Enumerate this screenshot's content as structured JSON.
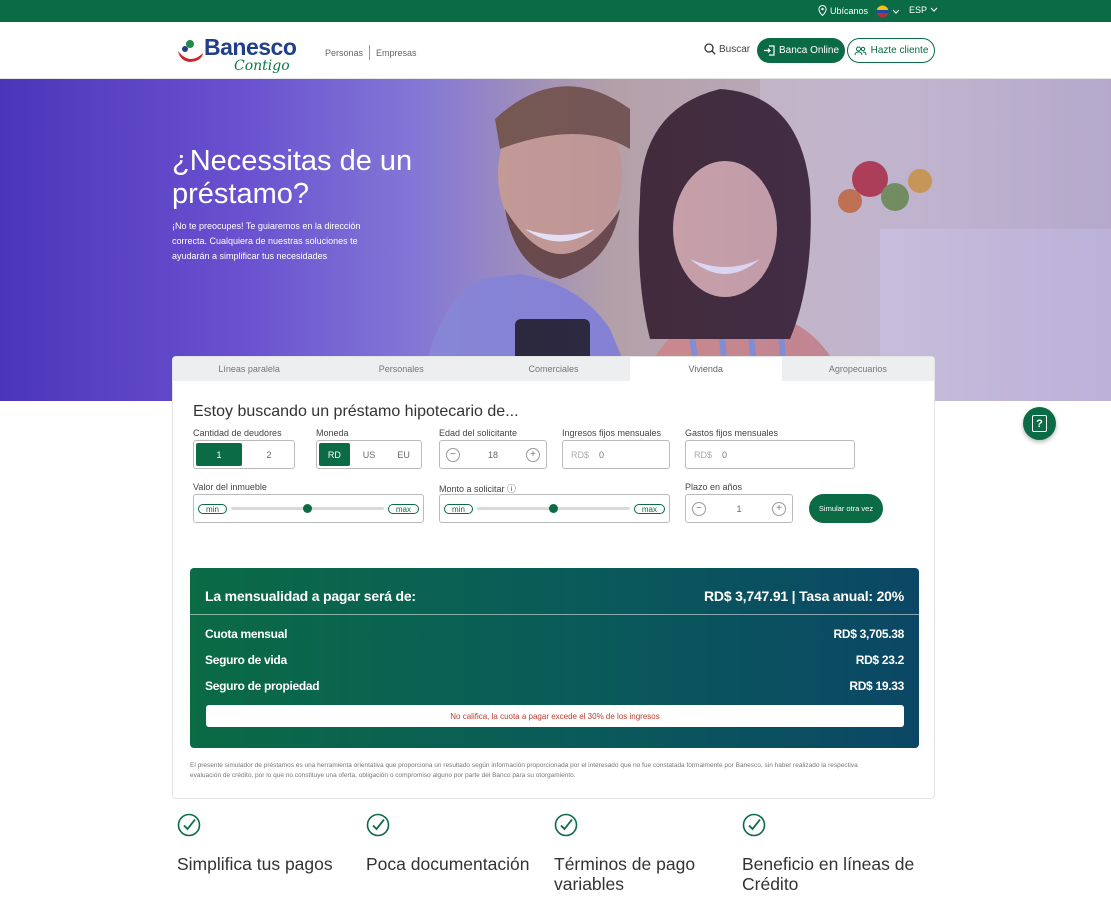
{
  "topbar": {
    "location": "Ubícanos",
    "language": "ESP"
  },
  "header": {
    "logo_name": "Banesco",
    "logo_tagline": "Contigo",
    "nav": [
      "Personas",
      "Empresas"
    ],
    "search_label": "Buscar",
    "online_label": "Banca Online",
    "client_label": "Hazte cliente"
  },
  "hero": {
    "title": "¿Necessitas de un préstamo?",
    "text": "¡No te preocupes! Te guiaremos en la dirección correcta. Cualquiera de nuestras soluciones te ayudarán a simplificar tus necesidades"
  },
  "simulator": {
    "tabs": [
      "Líneas paralela",
      "Personales",
      "Comerciales",
      "Vivienda",
      "Agropecuarios"
    ],
    "active_tab": "Vivienda",
    "heading": "Estoy buscando un préstamo hipotecario de...",
    "fields": {
      "deudores": {
        "label": "Cantidad de deudores",
        "options": [
          "1",
          "2"
        ],
        "selected": "1"
      },
      "moneda": {
        "label": "Moneda",
        "options": [
          "RD",
          "US",
          "EU"
        ],
        "selected": "RD"
      },
      "edad": {
        "label": "Edad del solicitante",
        "value": "18",
        "minus": "−",
        "plus": "+"
      },
      "ingresos": {
        "label": "Ingresos fijos mensuales",
        "currency": "RD$",
        "value": "0"
      },
      "gastos": {
        "label": "Gastos fijos mensuales",
        "currency": "RD$",
        "value": "0"
      },
      "valor": {
        "label": "Valor del inmueble",
        "min": "min",
        "max": "max",
        "level": 0.5
      },
      "monto": {
        "label": "Monto a solicitar ⓘ",
        "min": "min",
        "max": "max",
        "level": 0.5
      },
      "plazo": {
        "label": "Plazo en años",
        "value": "1",
        "minus": "−",
        "plus": "+"
      }
    },
    "simulate_label": "Simular otra vez",
    "result": {
      "heading": "La mensualidad a pagar será de:",
      "total": "RD$ 3,747.91 | Tasa anual: 20%",
      "rows": [
        {
          "label": "Cuota mensual",
          "value": "RD$ 3,705.38"
        },
        {
          "label": "Seguro de vida",
          "value": "RD$ 23.2"
        },
        {
          "label": "Seguro de propiedad",
          "value": "RD$ 19.33"
        }
      ],
      "warning": "No califica, la cuota a pagar excede el 30% de los ingresos"
    },
    "disclaimer": "El presente simulador de préstamos es una herramienta orientativa que proporciona un resultado según información proporcionada por el interesado que no fue constatada formalmente por Banesco, sin haber realizado la respectiva evaluación de crédito, por lo que no constituye una oferta, obligación o compromiso alguno por parte del Banco para su otorgamiento."
  },
  "help_label": "?",
  "features": [
    {
      "label": "Simplifica tus pagos"
    },
    {
      "label": "Poca documentación"
    },
    {
      "label": "Términos de pago variables"
    },
    {
      "label": "Beneficio en líneas de Crédito"
    }
  ],
  "colors": {
    "brand": "#0a6b45",
    "brand_blue": "#1f3f8a",
    "warning": "#c0392b"
  }
}
